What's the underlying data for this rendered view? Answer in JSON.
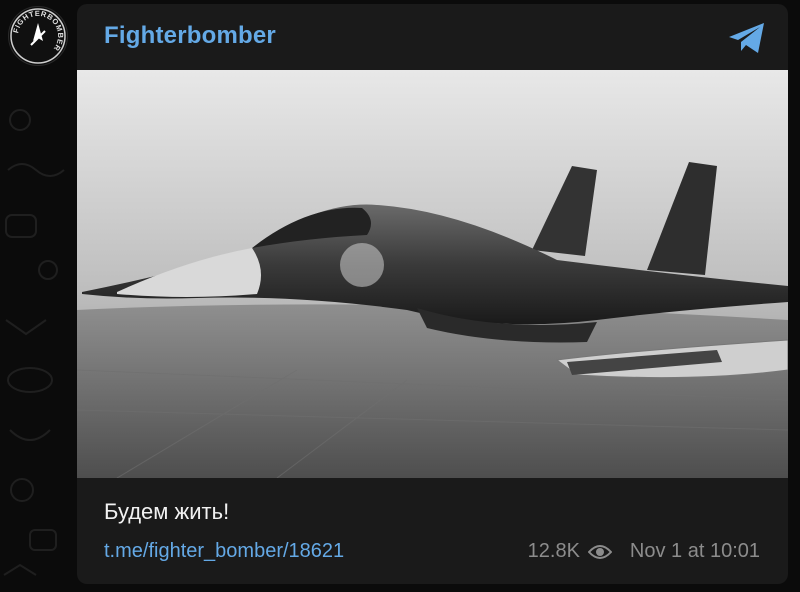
{
  "channel": {
    "name": "Fighterbomber",
    "avatar_text": "FIGHTERBOMBER"
  },
  "post": {
    "caption": "Будем жить!",
    "link": "t.me/fighter_bomber/18621",
    "views": "12.8K",
    "date": "Nov 1 at 10:01",
    "image_icon": "fighter-jet-photo"
  },
  "icons": {
    "share": "telegram-share-icon",
    "views": "eye-icon"
  },
  "colors": {
    "accent": "#64a9e6",
    "card": "#1a1a1a",
    "background": "#0b0b0b"
  }
}
